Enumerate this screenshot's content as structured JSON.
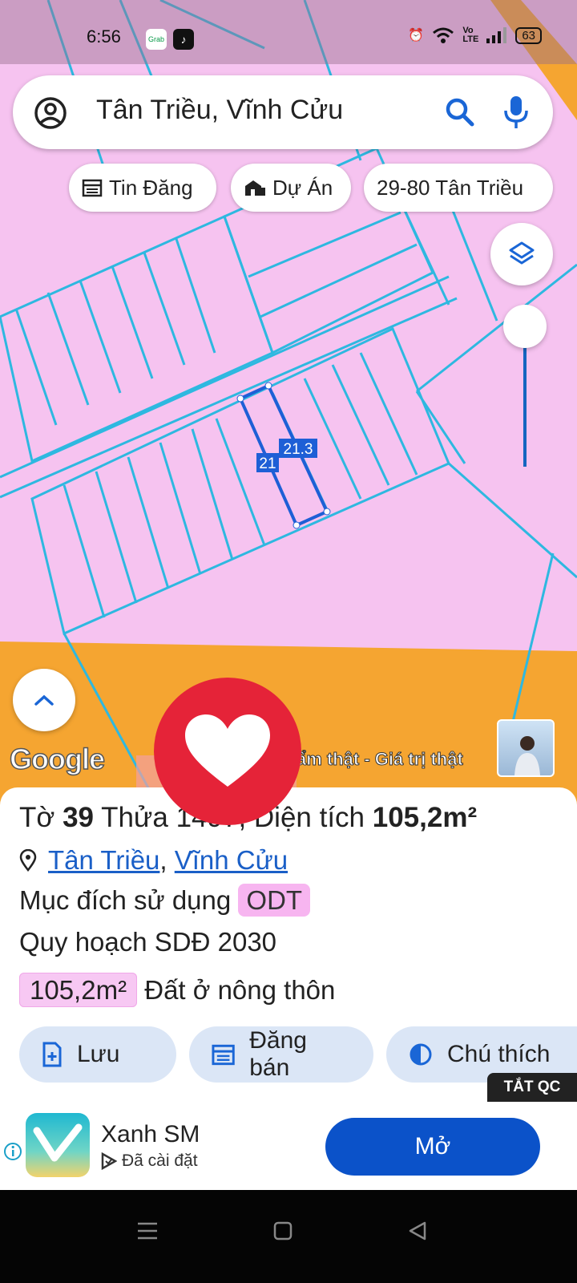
{
  "status": {
    "time": "6:56",
    "apps": [
      "Grab",
      "TikTok"
    ],
    "battery": "63"
  },
  "search": {
    "text": "Tân Triều, Vĩnh Cửu"
  },
  "chips": [
    {
      "label": "Tin Đăng",
      "icon": "calendar-icon"
    },
    {
      "label": "Dự Án",
      "icon": "building-icon"
    },
    {
      "label": "29-80 Tân Triều",
      "icon": ""
    }
  ],
  "map": {
    "dim_top": "21.3",
    "dim_side": "21",
    "brand": "Google",
    "watermark": "ẩm thật - Giá trị thật",
    "colors": {
      "residential": "#f6c3f0",
      "road": "#f5a531",
      "lines": "#2eb8e0",
      "selected": "#1e5fd6"
    }
  },
  "sheet": {
    "title_pre": "Tờ ",
    "sheet_no": "39",
    "title_mid": " Thửa ",
    "parcel_no": "1497",
    "title_post": ", Diện tích ",
    "area": "105,2m²",
    "location_ward": "Tân Triều",
    "location_sep": ", ",
    "location_district": "Vĩnh Cửu",
    "purpose_label": "Mục đích sử dụng",
    "purpose_code": "ODT",
    "plan_label": "Quy hoạch SDĐ 2030",
    "plan_area": "105,2m²",
    "plan_type": "Đất ở nông thôn"
  },
  "actions": [
    {
      "label": "Lưu",
      "icon": "add-file-icon"
    },
    {
      "label": "Đăng bán",
      "icon": "calendar-icon"
    },
    {
      "label": "Chú thích",
      "icon": "contrast-icon"
    }
  ],
  "ad": {
    "close_label": "TẮT QC",
    "name": "Xanh SM",
    "sub": "Đã cài đặt",
    "open": "Mở"
  }
}
